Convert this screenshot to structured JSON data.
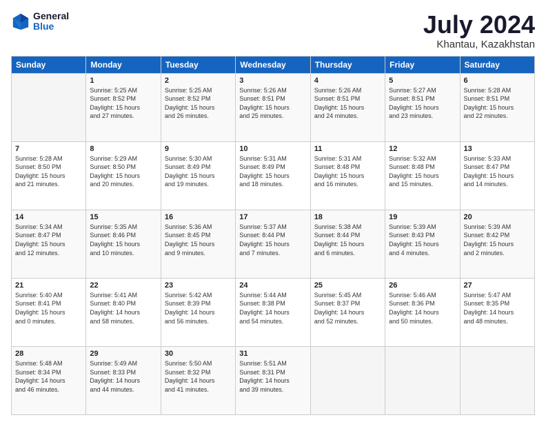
{
  "header": {
    "logo_general": "General",
    "logo_blue": "Blue",
    "title": "July 2024",
    "subtitle": "Khantau, Kazakhstan"
  },
  "days_of_week": [
    "Sunday",
    "Monday",
    "Tuesday",
    "Wednesday",
    "Thursday",
    "Friday",
    "Saturday"
  ],
  "weeks": [
    [
      {
        "day": "",
        "info": ""
      },
      {
        "day": "1",
        "info": "Sunrise: 5:25 AM\nSunset: 8:52 PM\nDaylight: 15 hours\nand 27 minutes."
      },
      {
        "day": "2",
        "info": "Sunrise: 5:25 AM\nSunset: 8:52 PM\nDaylight: 15 hours\nand 26 minutes."
      },
      {
        "day": "3",
        "info": "Sunrise: 5:26 AM\nSunset: 8:51 PM\nDaylight: 15 hours\nand 25 minutes."
      },
      {
        "day": "4",
        "info": "Sunrise: 5:26 AM\nSunset: 8:51 PM\nDaylight: 15 hours\nand 24 minutes."
      },
      {
        "day": "5",
        "info": "Sunrise: 5:27 AM\nSunset: 8:51 PM\nDaylight: 15 hours\nand 23 minutes."
      },
      {
        "day": "6",
        "info": "Sunrise: 5:28 AM\nSunset: 8:51 PM\nDaylight: 15 hours\nand 22 minutes."
      }
    ],
    [
      {
        "day": "7",
        "info": "Sunrise: 5:28 AM\nSunset: 8:50 PM\nDaylight: 15 hours\nand 21 minutes."
      },
      {
        "day": "8",
        "info": "Sunrise: 5:29 AM\nSunset: 8:50 PM\nDaylight: 15 hours\nand 20 minutes."
      },
      {
        "day": "9",
        "info": "Sunrise: 5:30 AM\nSunset: 8:49 PM\nDaylight: 15 hours\nand 19 minutes."
      },
      {
        "day": "10",
        "info": "Sunrise: 5:31 AM\nSunset: 8:49 PM\nDaylight: 15 hours\nand 18 minutes."
      },
      {
        "day": "11",
        "info": "Sunrise: 5:31 AM\nSunset: 8:48 PM\nDaylight: 15 hours\nand 16 minutes."
      },
      {
        "day": "12",
        "info": "Sunrise: 5:32 AM\nSunset: 8:48 PM\nDaylight: 15 hours\nand 15 minutes."
      },
      {
        "day": "13",
        "info": "Sunrise: 5:33 AM\nSunset: 8:47 PM\nDaylight: 15 hours\nand 14 minutes."
      }
    ],
    [
      {
        "day": "14",
        "info": "Sunrise: 5:34 AM\nSunset: 8:47 PM\nDaylight: 15 hours\nand 12 minutes."
      },
      {
        "day": "15",
        "info": "Sunrise: 5:35 AM\nSunset: 8:46 PM\nDaylight: 15 hours\nand 10 minutes."
      },
      {
        "day": "16",
        "info": "Sunrise: 5:36 AM\nSunset: 8:45 PM\nDaylight: 15 hours\nand 9 minutes."
      },
      {
        "day": "17",
        "info": "Sunrise: 5:37 AM\nSunset: 8:44 PM\nDaylight: 15 hours\nand 7 minutes."
      },
      {
        "day": "18",
        "info": "Sunrise: 5:38 AM\nSunset: 8:44 PM\nDaylight: 15 hours\nand 6 minutes."
      },
      {
        "day": "19",
        "info": "Sunrise: 5:39 AM\nSunset: 8:43 PM\nDaylight: 15 hours\nand 4 minutes."
      },
      {
        "day": "20",
        "info": "Sunrise: 5:39 AM\nSunset: 8:42 PM\nDaylight: 15 hours\nand 2 minutes."
      }
    ],
    [
      {
        "day": "21",
        "info": "Sunrise: 5:40 AM\nSunset: 8:41 PM\nDaylight: 15 hours\nand 0 minutes."
      },
      {
        "day": "22",
        "info": "Sunrise: 5:41 AM\nSunset: 8:40 PM\nDaylight: 14 hours\nand 58 minutes."
      },
      {
        "day": "23",
        "info": "Sunrise: 5:42 AM\nSunset: 8:39 PM\nDaylight: 14 hours\nand 56 minutes."
      },
      {
        "day": "24",
        "info": "Sunrise: 5:44 AM\nSunset: 8:38 PM\nDaylight: 14 hours\nand 54 minutes."
      },
      {
        "day": "25",
        "info": "Sunrise: 5:45 AM\nSunset: 8:37 PM\nDaylight: 14 hours\nand 52 minutes."
      },
      {
        "day": "26",
        "info": "Sunrise: 5:46 AM\nSunset: 8:36 PM\nDaylight: 14 hours\nand 50 minutes."
      },
      {
        "day": "27",
        "info": "Sunrise: 5:47 AM\nSunset: 8:35 PM\nDaylight: 14 hours\nand 48 minutes."
      }
    ],
    [
      {
        "day": "28",
        "info": "Sunrise: 5:48 AM\nSunset: 8:34 PM\nDaylight: 14 hours\nand 46 minutes."
      },
      {
        "day": "29",
        "info": "Sunrise: 5:49 AM\nSunset: 8:33 PM\nDaylight: 14 hours\nand 44 minutes."
      },
      {
        "day": "30",
        "info": "Sunrise: 5:50 AM\nSunset: 8:32 PM\nDaylight: 14 hours\nand 41 minutes."
      },
      {
        "day": "31",
        "info": "Sunrise: 5:51 AM\nSunset: 8:31 PM\nDaylight: 14 hours\nand 39 minutes."
      },
      {
        "day": "",
        "info": ""
      },
      {
        "day": "",
        "info": ""
      },
      {
        "day": "",
        "info": ""
      }
    ]
  ]
}
